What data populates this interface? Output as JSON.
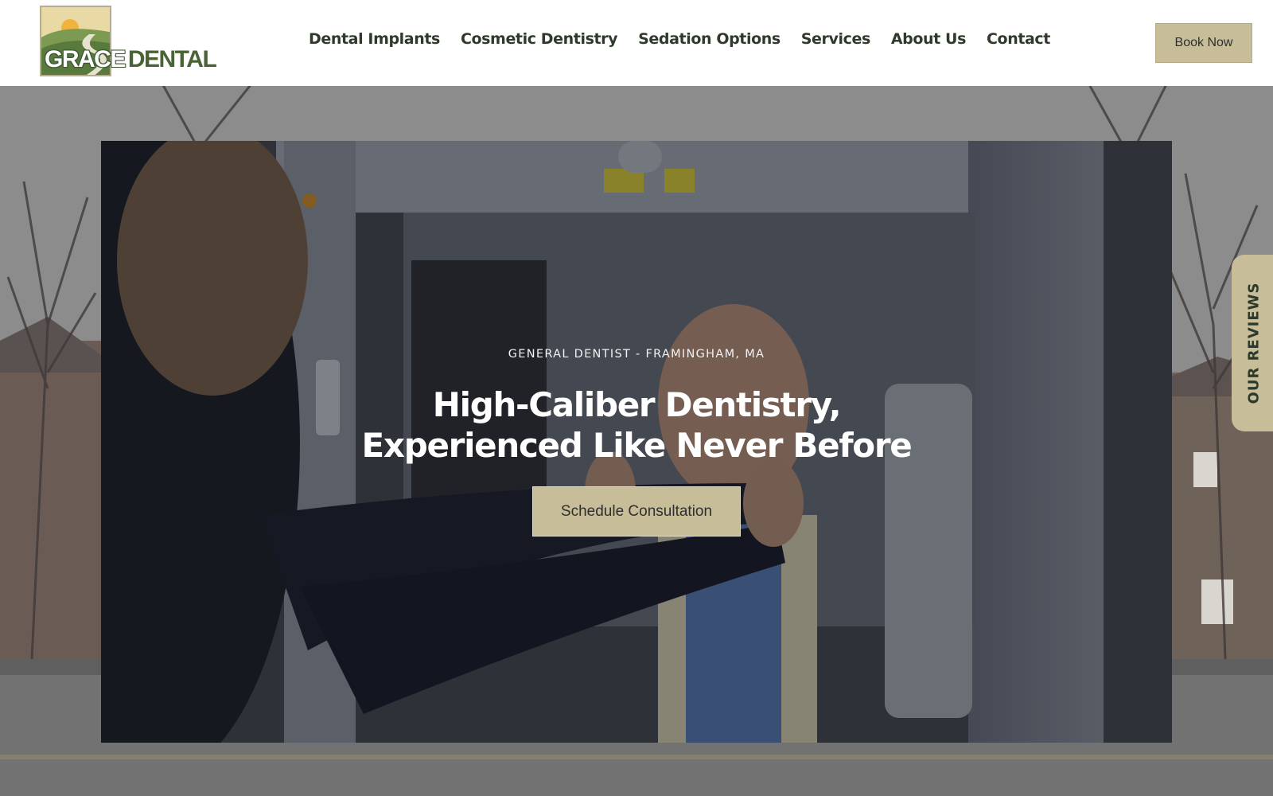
{
  "brand": {
    "name_part1": "GRACE",
    "name_part2": "DENTAL"
  },
  "nav": {
    "items": [
      {
        "label": "Dental Implants"
      },
      {
        "label": "Cosmetic Dentistry"
      },
      {
        "label": "Sedation Options"
      },
      {
        "label": "Services"
      },
      {
        "label": "About Us"
      },
      {
        "label": "Contact"
      }
    ],
    "book_label": "Book Now"
  },
  "hero": {
    "eyebrow": "GENERAL DENTIST - FRAMINGHAM, MA",
    "title_line1": "High-Caliber Dentistry,",
    "title_line2": "Experienced Like Never Before",
    "cta_label": "Schedule Consultation"
  },
  "reviews_tab": {
    "label": "OUR REVIEWS"
  },
  "colors": {
    "accent": "#c7bd98",
    "nav_text": "#2f3a2c",
    "brand_green": "#4a6335"
  }
}
